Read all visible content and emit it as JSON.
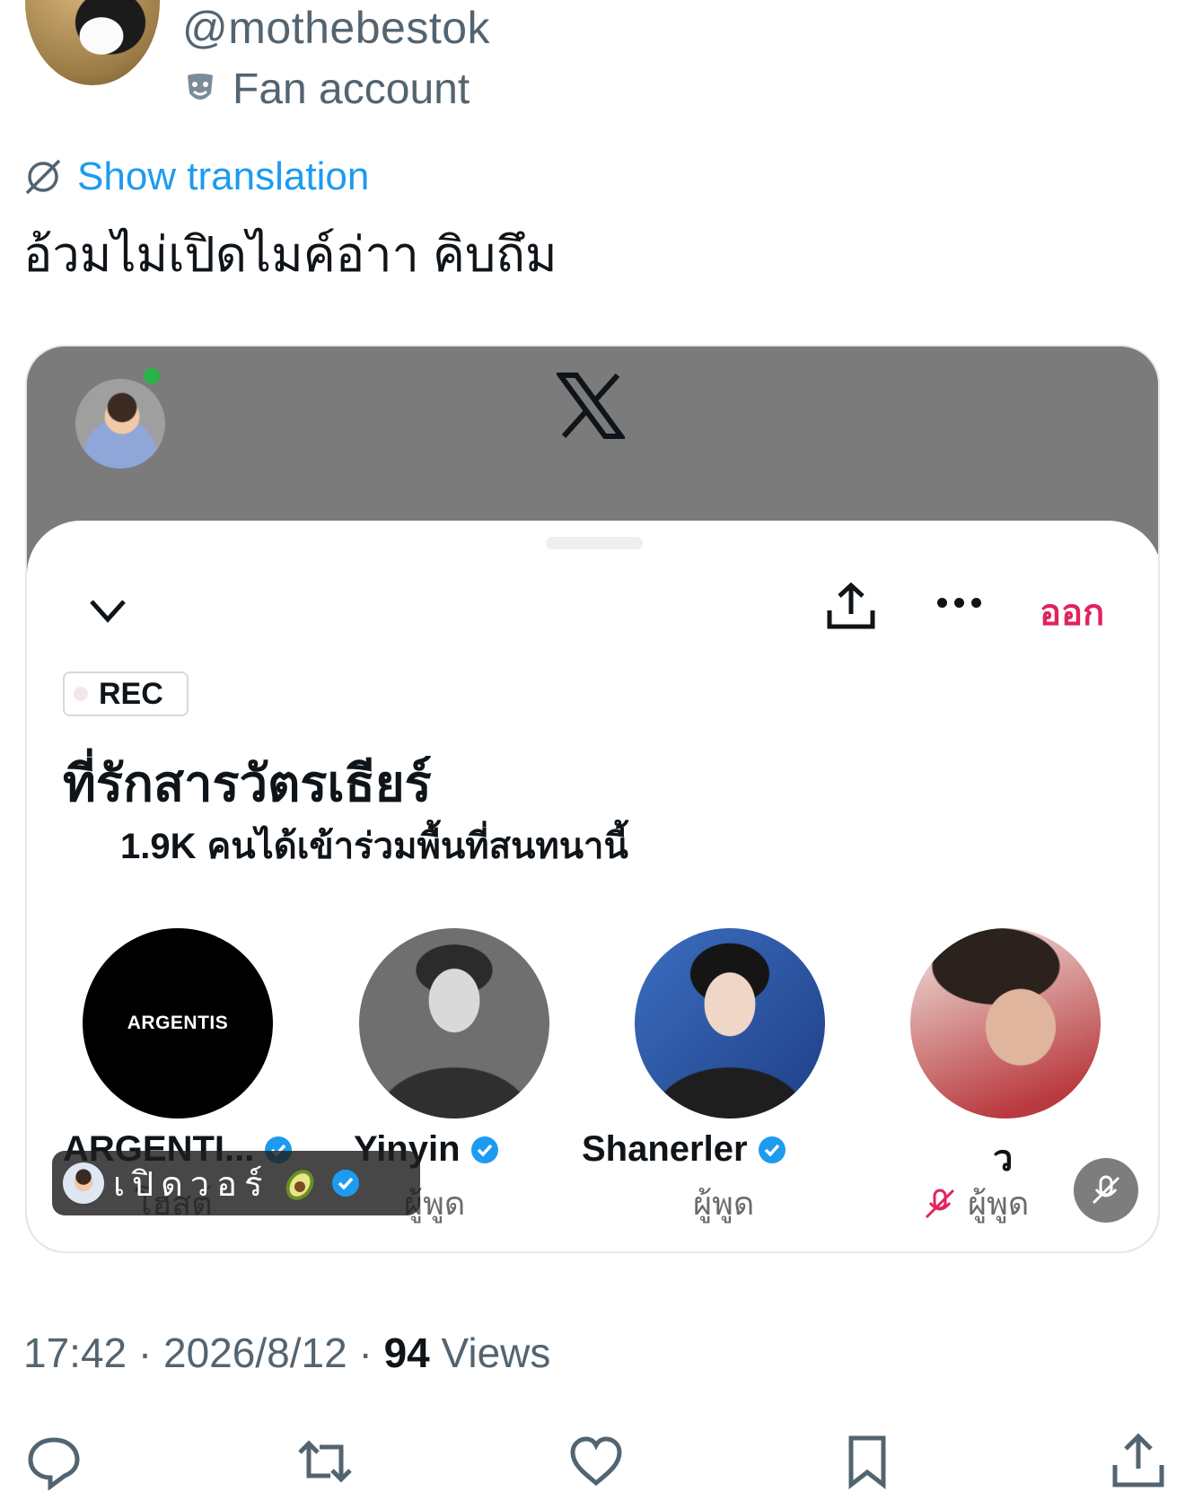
{
  "header": {
    "handle": "@mothebestok",
    "label": "Fan account",
    "label_icon": "theater-mask-icon"
  },
  "tweet": {
    "show_translation": "Show translation",
    "text": "อ้วมไม่เปิดไมค์อ่าา คิบถึม"
  },
  "embedded": {
    "logo": "X",
    "space": {
      "leave_label": "ออก",
      "rec_label": "REC",
      "title": "ที่รักสารวัตรเธียร์",
      "listeners_count": "1.9K",
      "listeners_text": "คนได้เข้าร่วมพื้นที่สนทนานี้",
      "speakers": [
        {
          "name": "ARGENTI...",
          "avatar_text": "ARGENTIS",
          "role": "โฮสต์",
          "verified": true
        },
        {
          "name": "Yinyin",
          "role": "ผู้พูด",
          "verified": true
        },
        {
          "name": "Shanerler",
          "role": "ผู้พูด",
          "verified": true
        },
        {
          "name": "ว",
          "role": "ผู้พูด",
          "verified": false,
          "muted": true
        }
      ],
      "overlay_user": "เปิดวอร์"
    },
    "colors": {
      "leave": "#e0245e",
      "verified": "#1d9bf0"
    }
  },
  "meta": {
    "time": "17:42",
    "date": "2026/8/12",
    "views_count": "94",
    "views_label": "Views"
  },
  "actions": [
    "reply-icon",
    "retweet-icon",
    "like-icon",
    "bookmark-icon",
    "share-icon"
  ]
}
